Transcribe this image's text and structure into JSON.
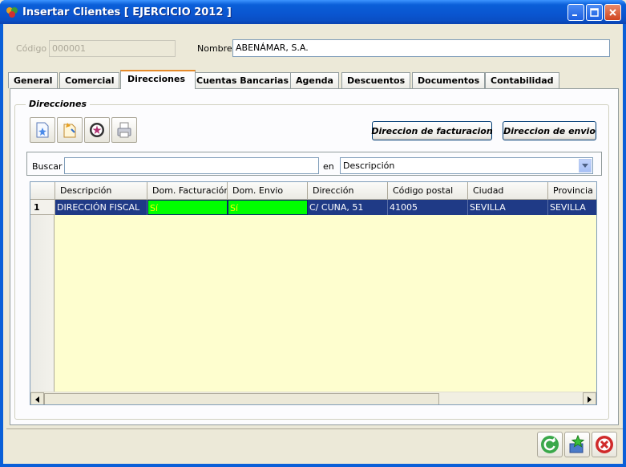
{
  "window": {
    "title": "Insertar Clientes [ EJERCICIO 2012 ]",
    "icon": "app-icon"
  },
  "header": {
    "codigo_label": "Código",
    "codigo_value": "000001",
    "nombre_label": "Nombre",
    "nombre_value": "ABENÁMAR, S.A."
  },
  "tabs": [
    {
      "label": "General",
      "active": false
    },
    {
      "label": "Comercial",
      "active": false
    },
    {
      "label": "Direcciones",
      "active": true
    },
    {
      "label": "Cuentas Bancarias",
      "active": false
    },
    {
      "label": "Agenda",
      "active": false
    },
    {
      "label": "Descuentos",
      "active": false
    },
    {
      "label": "Documentos",
      "active": false
    },
    {
      "label": "Contabilidad",
      "active": false
    }
  ],
  "direcciones": {
    "group_title": "Direcciones",
    "toolbar_icons": [
      "new-record-icon",
      "edit-record-icon",
      "delete-record-icon",
      "print-icon"
    ],
    "btn_facturacion": "Direccion de facturacion",
    "btn_envio": "Direccion de envio",
    "search_label": "Buscar",
    "search_value": "",
    "en_label": "en",
    "search_field": "Descripción"
  },
  "grid": {
    "columns": [
      "Descripción",
      "Dom. Facturación",
      "Dom. Envio",
      "Dirección",
      "Código postal",
      "Ciudad",
      "Provincia"
    ],
    "rows": [
      {
        "index": "1",
        "cells": [
          "DIRECCIÓN FISCAL",
          "Sí",
          "Sí",
          "C/ CUNA, 51",
          "41005",
          "SEVILLA",
          "SEVILLA"
        ]
      }
    ]
  },
  "colors": {
    "selection": "#1f3a86",
    "flag_cell": "#00ff00",
    "grid_background": "#fefecf"
  },
  "footer_icons": [
    "refresh-icon",
    "save-star-icon",
    "cancel-icon"
  ]
}
